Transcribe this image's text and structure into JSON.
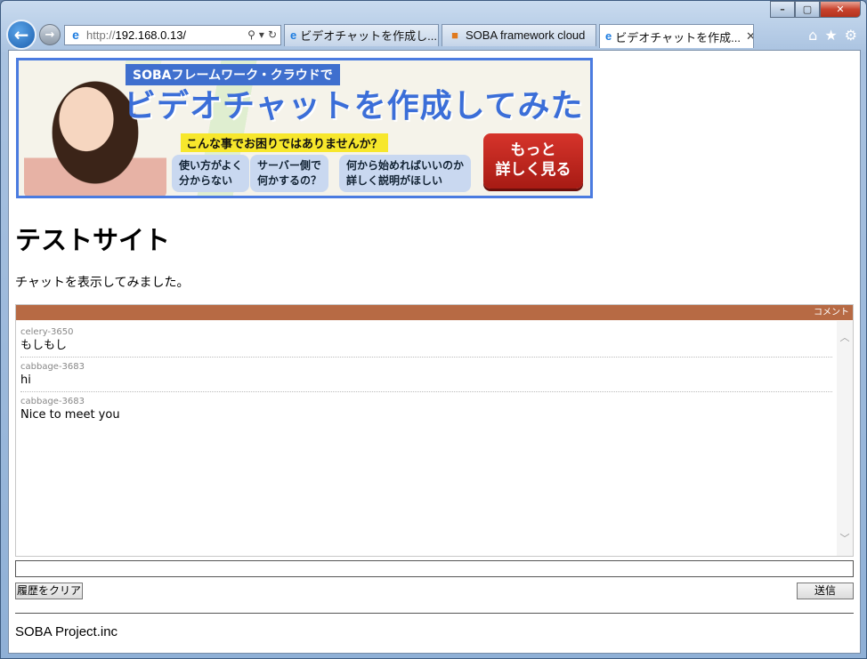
{
  "browser": {
    "address": {
      "proto": "http://",
      "host": "192.168.0.13/"
    },
    "tabs": [
      {
        "label": "ビデオチャットを作成し..."
      },
      {
        "label": "SOBA framework cloud"
      },
      {
        "label": "ビデオチャットを作成..."
      }
    ],
    "window_controls": {
      "min": "–",
      "max": "▢",
      "close": "✕"
    }
  },
  "banner": {
    "subtitle": "SOBAフレームワーク・クラウドで",
    "title": "ビデオチャットを作成してみた",
    "question": "こんな事でお困りではありませんか？",
    "pills": [
      {
        "line1": "使い方がよく",
        "line2": "分からない"
      },
      {
        "line1": "サーバー側で",
        "line2": "何かするの？"
      },
      {
        "line1": "何から始めればいいのか",
        "line2": "詳しく説明がほしい"
      }
    ],
    "cta_line1": "もっと",
    "cta_line2": "詳しく見る",
    "colors": {
      "border": "#4a7be0",
      "title": "#3b6ed8",
      "cta": "#c0261f"
    }
  },
  "page": {
    "title": "テストサイト",
    "description": "チャットを表示してみました。"
  },
  "chat": {
    "header": "コメント",
    "header_color": "#b76a44",
    "messages": [
      {
        "user": "celery-3650",
        "text": "もしもし"
      },
      {
        "user": "cabbage-3683",
        "text": "hi"
      },
      {
        "user": "cabbage-3683",
        "text": "Nice to meet you"
      }
    ],
    "input_value": "",
    "clear_label": "履歴をクリア",
    "send_label": "送信"
  },
  "footer": {
    "text": "SOBA Project.inc"
  }
}
